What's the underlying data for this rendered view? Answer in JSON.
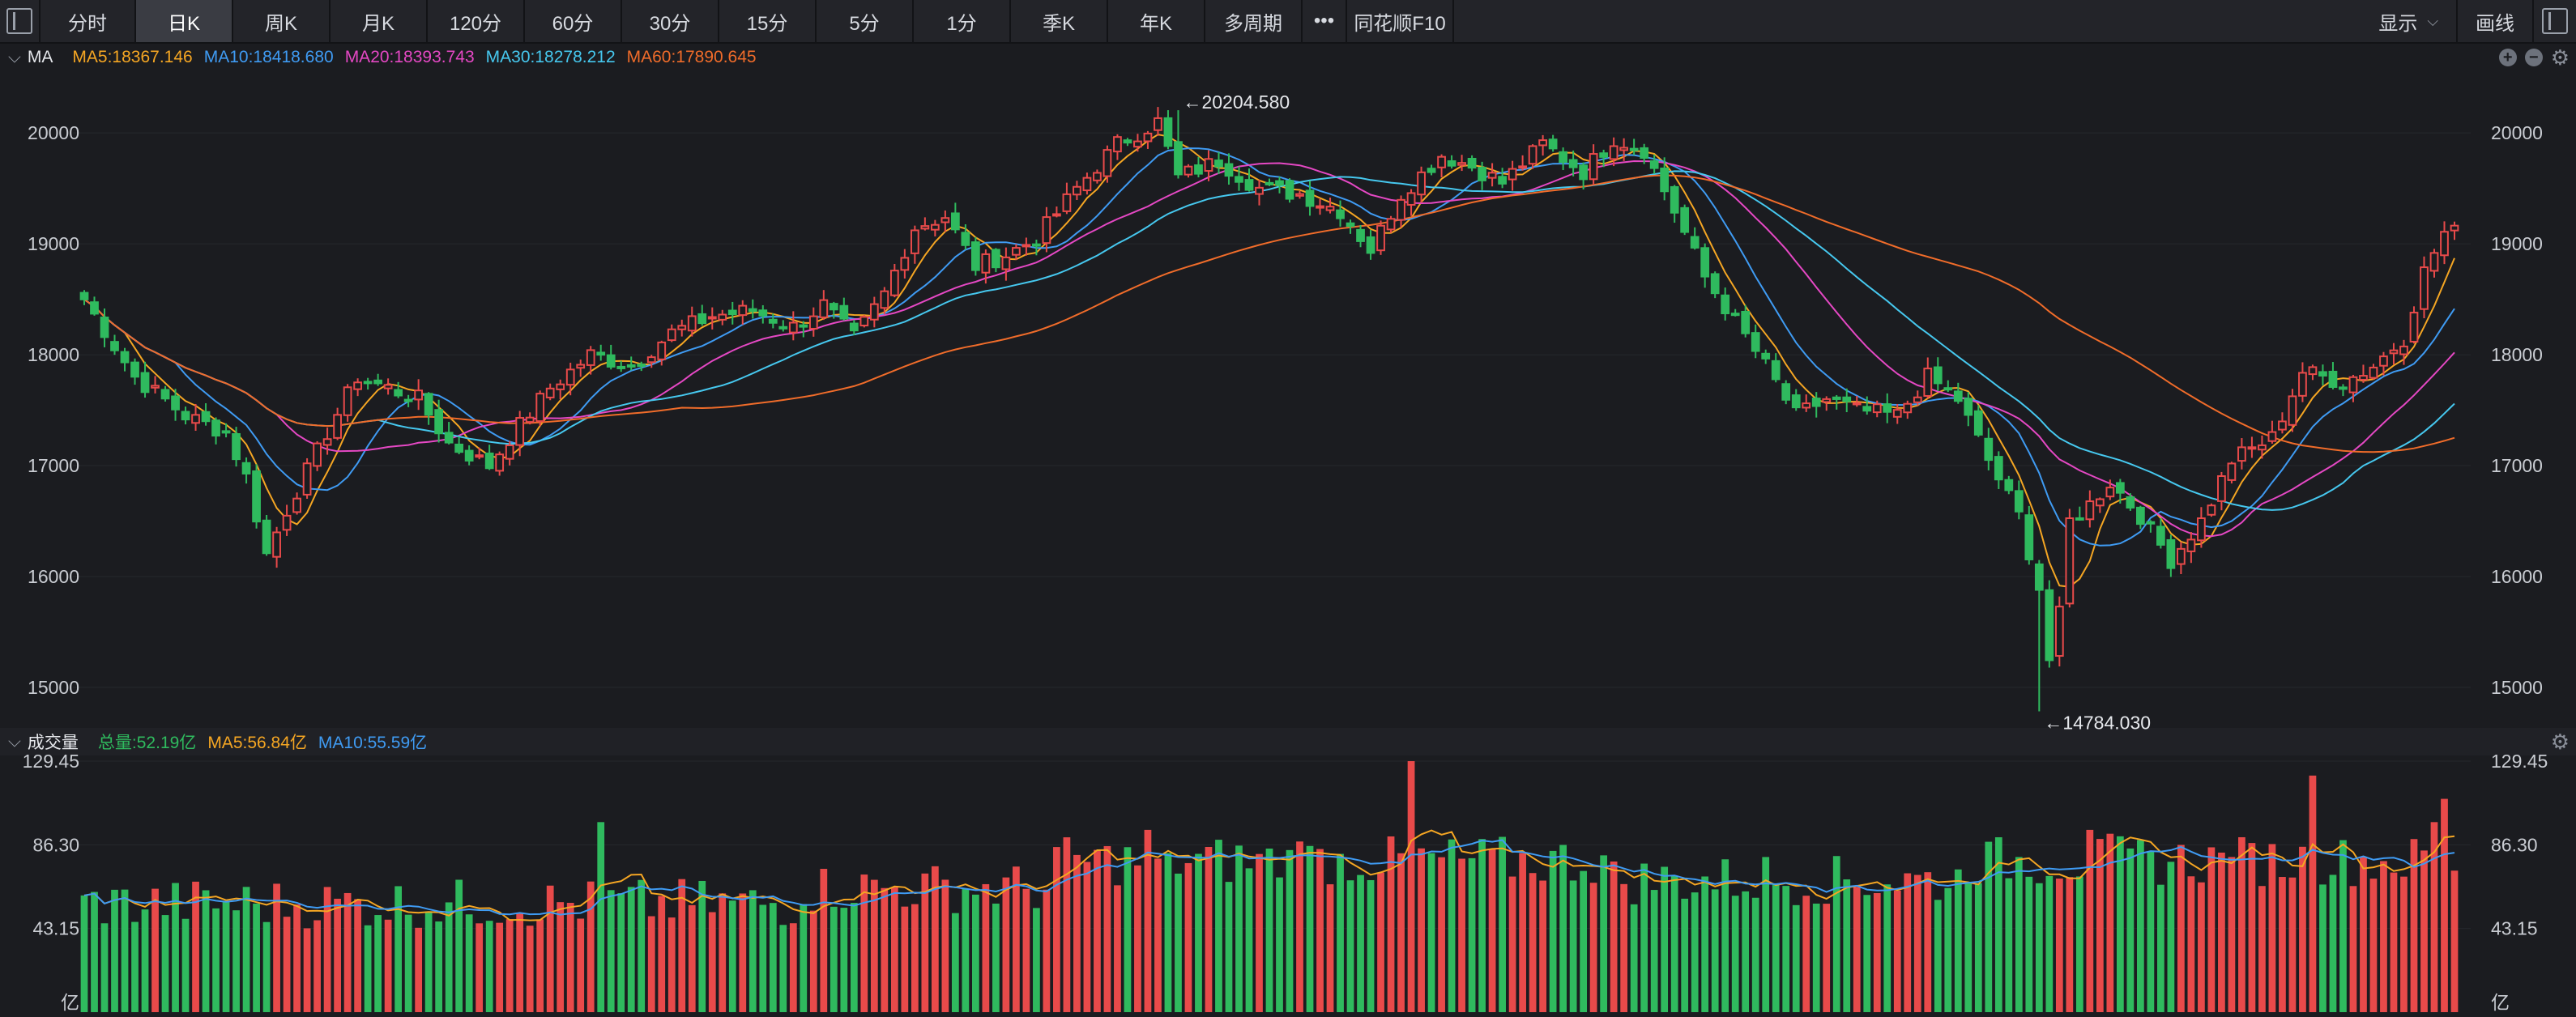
{
  "toolbar": {
    "tabs": [
      {
        "label": "分时",
        "active": false
      },
      {
        "label": "日K",
        "active": true
      },
      {
        "label": "周K",
        "active": false
      },
      {
        "label": "月K",
        "active": false
      },
      {
        "label": "120分",
        "active": false
      },
      {
        "label": "60分",
        "active": false
      },
      {
        "label": "30分",
        "active": false
      },
      {
        "label": "15分",
        "active": false
      },
      {
        "label": "5分",
        "active": false
      },
      {
        "label": "1分",
        "active": false
      },
      {
        "label": "季K",
        "active": false
      },
      {
        "label": "年K",
        "active": false
      },
      {
        "label": "多周期",
        "active": false
      },
      {
        "label": "•••",
        "active": false
      },
      {
        "label": "同花顺F10",
        "active": false
      }
    ],
    "display_label": "显示",
    "draw_label": "画线"
  },
  "price_legend": {
    "name": "MA",
    "items": [
      {
        "label": "MA5:18367.146",
        "color": "#f5a623"
      },
      {
        "label": "MA10:18418.680",
        "color": "#3f9bf3"
      },
      {
        "label": "MA20:18393.743",
        "color": "#e548c4"
      },
      {
        "label": "MA30:18278.212",
        "color": "#46c8ef"
      },
      {
        "label": "MA60:17890.645",
        "color": "#f06c2a"
      }
    ]
  },
  "volume_legend": {
    "name": "成交量",
    "items": [
      {
        "label": "总量:52.19亿",
        "color": "#2fba5e"
      },
      {
        "label": "MA5:56.84亿",
        "color": "#f5a623"
      },
      {
        "label": "MA10:55.59亿",
        "color": "#3f9bf3"
      }
    ]
  },
  "chart_data": [
    {
      "type": "candlestick",
      "y_ticks": [
        "20000",
        "19000",
        "18000",
        "17000",
        "16000",
        "15000"
      ],
      "ylim": [
        14700,
        20600
      ],
      "annotations": [
        {
          "label": "←20204.580",
          "value": 20204.58
        },
        {
          "label": "←14784.030",
          "value": 14784.03
        }
      ],
      "colors": {
        "up": "#e84a4a",
        "down": "#2fba5e"
      },
      "anchors": [
        [
          0,
          18500
        ],
        [
          5,
          17800
        ],
        [
          10,
          17450
        ],
        [
          14,
          17300
        ],
        [
          16,
          16900
        ],
        [
          18,
          16200
        ],
        [
          20,
          16600
        ],
        [
          24,
          17300
        ],
        [
          27,
          17800
        ],
        [
          30,
          17700
        ],
        [
          33,
          17600
        ],
        [
          36,
          17200
        ],
        [
          38,
          17100
        ],
        [
          40,
          17000
        ],
        [
          42,
          17250
        ],
        [
          46,
          17700
        ],
        [
          50,
          18000
        ],
        [
          54,
          17900
        ],
        [
          58,
          18200
        ],
        [
          62,
          18350
        ],
        [
          66,
          18400
        ],
        [
          70,
          18250
        ],
        [
          73,
          18450
        ],
        [
          76,
          18150
        ],
        [
          79,
          18550
        ],
        [
          82,
          19150
        ],
        [
          85,
          19250
        ],
        [
          88,
          18800
        ],
        [
          91,
          18900
        ],
        [
          94,
          19050
        ],
        [
          98,
          19500
        ],
        [
          102,
          19900
        ],
        [
          106,
          20100
        ],
        [
          108,
          19600
        ],
        [
          112,
          19750
        ],
        [
          116,
          19500
        ],
        [
          120,
          19450
        ],
        [
          124,
          19300
        ],
        [
          127,
          18950
        ],
        [
          130,
          19450
        ],
        [
          134,
          19800
        ],
        [
          137,
          19700
        ],
        [
          140,
          19550
        ],
        [
          144,
          19900
        ],
        [
          148,
          19650
        ],
        [
          151,
          19950
        ],
        [
          154,
          19850
        ],
        [
          157,
          19300
        ],
        [
          160,
          18700
        ],
        [
          163,
          18300
        ],
        [
          166,
          17900
        ],
        [
          169,
          17450
        ],
        [
          172,
          17600
        ],
        [
          175,
          17500
        ],
        [
          179,
          17450
        ],
        [
          182,
          17800
        ],
        [
          185,
          17600
        ],
        [
          188,
          17050
        ],
        [
          191,
          16550
        ],
        [
          193,
          15900
        ],
        [
          194,
          15250
        ],
        [
          195,
          15650
        ],
        [
          196,
          16500
        ],
        [
          198,
          16650
        ],
        [
          200,
          16850
        ],
        [
          203,
          16550
        ],
        [
          206,
          16150
        ],
        [
          209,
          16500
        ],
        [
          212,
          17050
        ],
        [
          216,
          17250
        ],
        [
          219,
          17850
        ],
        [
          223,
          17750
        ],
        [
          226,
          17900
        ],
        [
          229,
          18150
        ],
        [
          231,
          18750
        ],
        [
          233,
          19100
        ]
      ],
      "wicks": [
        {
          "index": 193,
          "low": 14784.03
        },
        {
          "index": 108,
          "high": 20204.58
        }
      ],
      "series": [
        {
          "name": "MA5"
        },
        {
          "name": "MA10"
        },
        {
          "name": "MA20"
        },
        {
          "name": "MA30"
        },
        {
          "name": "MA60"
        }
      ]
    },
    {
      "type": "bar",
      "y_ticks": [
        "129.45",
        "86.30",
        "43.15"
      ],
      "ylim": [
        0,
        129.45
      ],
      "unit": "亿",
      "base": 56,
      "spikes": [
        {
          "index": 51,
          "value": 98
        },
        {
          "index": 105,
          "value": 94
        },
        {
          "index": 107,
          "value": 82
        },
        {
          "index": 120,
          "value": 88
        },
        {
          "index": 131,
          "value": 129.45
        },
        {
          "index": 142,
          "value": 82
        },
        {
          "index": 166,
          "value": 80
        },
        {
          "index": 191,
          "value": 80
        },
        {
          "index": 198,
          "value": 94
        },
        {
          "index": 200,
          "value": 92
        },
        {
          "index": 212,
          "value": 80
        },
        {
          "index": 220,
          "value": 122
        },
        {
          "index": 232,
          "value": 98
        },
        {
          "index": 233,
          "value": 110
        }
      ],
      "series": [
        {
          "name": "总量"
        },
        {
          "name": "MA5"
        },
        {
          "name": "MA10"
        }
      ]
    }
  ]
}
